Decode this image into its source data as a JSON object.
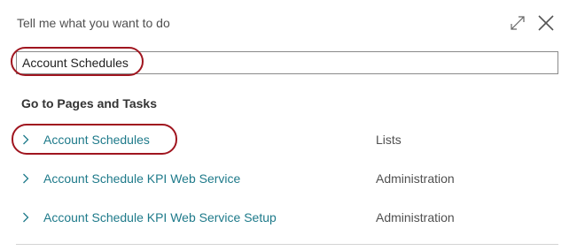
{
  "dialog": {
    "title": "Tell me what you want to do",
    "icons": {
      "expand": "expand-icon",
      "close": "close-icon"
    }
  },
  "search": {
    "value": "Account Schedules",
    "placeholder": ""
  },
  "results": {
    "heading": "Go to Pages and Tasks",
    "items": [
      {
        "name": "Account Schedules",
        "category": "Lists"
      },
      {
        "name": "Account Schedule KPI Web Service",
        "category": "Administration"
      },
      {
        "name": "Account Schedule KPI Web Service Setup",
        "category": "Administration"
      }
    ]
  },
  "colors": {
    "link": "#1e7a8a",
    "highlight": "#a0151f",
    "text": "#505050"
  }
}
